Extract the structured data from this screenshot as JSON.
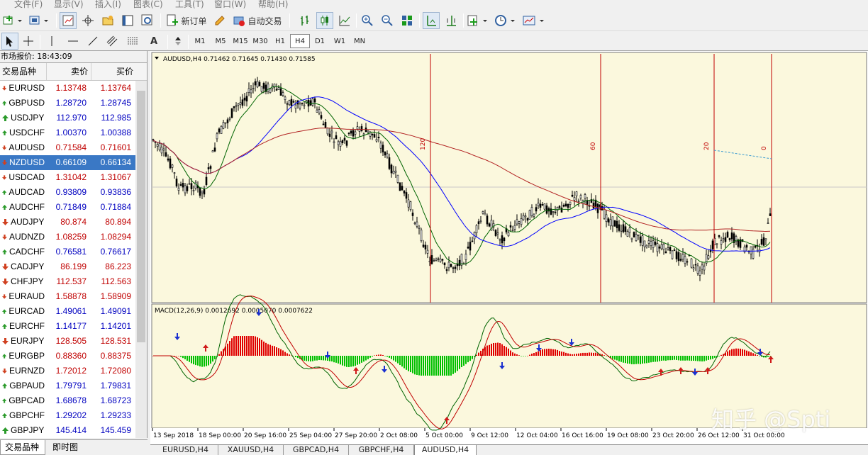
{
  "menu": [
    "文件(F)",
    "显示(V)",
    "插入(I)",
    "图表(C)",
    "工具(T)",
    "窗口(W)",
    "帮助(H)"
  ],
  "toolbar": {
    "new_order": "新订单",
    "auto_trading": "自动交易",
    "text_tool": "A"
  },
  "timeframes": [
    "M1",
    "M5",
    "M15",
    "M30",
    "H1",
    "H4",
    "D1",
    "W1",
    "MN"
  ],
  "active_timeframe": "H4",
  "market_watch": {
    "title": "市场报价: 18:43:09",
    "col_symbol": "交易品种",
    "col_bid": "卖价",
    "col_ask": "买价",
    "rows": [
      {
        "symbol": "EURUSD",
        "bid": "1.13748",
        "ask": "1.13764",
        "dir": "down",
        "color": "#c00000"
      },
      {
        "symbol": "GBPUSD",
        "bid": "1.28720",
        "ask": "1.28745",
        "dir": "up",
        "color": "#0000c0"
      },
      {
        "symbol": "USDJPY",
        "bid": "112.970",
        "ask": "112.985",
        "dir": "up",
        "color": "#0000c0"
      },
      {
        "symbol": "USDCHF",
        "bid": "1.00370",
        "ask": "1.00388",
        "dir": "up",
        "color": "#0000c0"
      },
      {
        "symbol": "AUDUSD",
        "bid": "0.71584",
        "ask": "0.71601",
        "dir": "down",
        "color": "#c00000"
      },
      {
        "symbol": "NZDUSD",
        "bid": "0.66109",
        "ask": "0.66134",
        "dir": "down",
        "color": "#c00000"
      },
      {
        "symbol": "USDCAD",
        "bid": "1.31042",
        "ask": "1.31067",
        "dir": "down",
        "color": "#c00000"
      },
      {
        "symbol": "AUDCAD",
        "bid": "0.93809",
        "ask": "0.93836",
        "dir": "up",
        "color": "#0000c0"
      },
      {
        "symbol": "AUDCHF",
        "bid": "0.71849",
        "ask": "0.71884",
        "dir": "up",
        "color": "#0000c0"
      },
      {
        "symbol": "AUDJPY",
        "bid": "80.874",
        "ask": "80.894",
        "dir": "down",
        "color": "#c00000"
      },
      {
        "symbol": "AUDNZD",
        "bid": "1.08259",
        "ask": "1.08294",
        "dir": "down",
        "color": "#c00000"
      },
      {
        "symbol": "CADCHF",
        "bid": "0.76581",
        "ask": "0.76617",
        "dir": "up",
        "color": "#0000c0"
      },
      {
        "symbol": "CADJPY",
        "bid": "86.199",
        "ask": "86.223",
        "dir": "down",
        "color": "#c00000"
      },
      {
        "symbol": "CHFJPY",
        "bid": "112.537",
        "ask": "112.563",
        "dir": "down",
        "color": "#c00000"
      },
      {
        "symbol": "EURAUD",
        "bid": "1.58878",
        "ask": "1.58909",
        "dir": "down",
        "color": "#c00000"
      },
      {
        "symbol": "EURCAD",
        "bid": "1.49061",
        "ask": "1.49091",
        "dir": "up",
        "color": "#0000c0"
      },
      {
        "symbol": "EURCHF",
        "bid": "1.14177",
        "ask": "1.14201",
        "dir": "up",
        "color": "#0000c0"
      },
      {
        "symbol": "EURJPY",
        "bid": "128.505",
        "ask": "128.531",
        "dir": "down",
        "color": "#c00000"
      },
      {
        "symbol": "EURGBP",
        "bid": "0.88360",
        "ask": "0.88375",
        "dir": "up",
        "color": "#c00000"
      },
      {
        "symbol": "EURNZD",
        "bid": "1.72012",
        "ask": "1.72080",
        "dir": "down",
        "color": "#c00000"
      },
      {
        "symbol": "GBPAUD",
        "bid": "1.79791",
        "ask": "1.79831",
        "dir": "up",
        "color": "#0000c0"
      },
      {
        "symbol": "GBPCAD",
        "bid": "1.68678",
        "ask": "1.68723",
        "dir": "up",
        "color": "#0000c0"
      },
      {
        "symbol": "GBPCHF",
        "bid": "1.29202",
        "ask": "1.29233",
        "dir": "up",
        "color": "#0000c0"
      },
      {
        "symbol": "GBPJPY",
        "bid": "145.414",
        "ask": "145.459",
        "dir": "up",
        "color": "#0000c0"
      }
    ],
    "selected": "NZDUSD",
    "tabs": [
      "交易品种",
      "即时图"
    ]
  },
  "chart": {
    "header": "AUDUSD,H4  0.71462 0.71645 0.71430 0.71585",
    "macd_header": "MACD(12,26,9) 0.0012692 0.0005070 0.0007622",
    "vlines": [
      {
        "label": "120"
      },
      {
        "label": "60"
      },
      {
        "label": "20"
      },
      {
        "label": "0"
      }
    ],
    "time_labels": [
      "13 Sep 2018",
      "18 Sep 00:00",
      "20 Sep 16:00",
      "25 Sep 04:00",
      "27 Sep 20:00",
      "2 Oct 08:00",
      "5 Oct 00:00",
      "9 Oct 12:00",
      "12 Oct 04:00",
      "16 Oct 16:00",
      "19 Oct 08:00",
      "23 Oct 20:00",
      "26 Oct 12:00",
      "31 Oct 00:00"
    ],
    "colors": {
      "bg": "#fbf8dd",
      "up": "#000000",
      "down": "#000000",
      "ma_fast": "#006400",
      "ma_mid": "#0000ff",
      "ma_slow": "#b22222",
      "vline": "#c00000",
      "macd_pos": "#e00000",
      "macd_neg": "#00c000"
    }
  },
  "bottom_tabs": [
    "EURUSD,H4",
    "XAUUSD,H4",
    "GBPCAD,H4",
    "GBPCHF,H4",
    "AUDUSD,H4"
  ],
  "active_tab": "AUDUSD,H4",
  "watermark": "知乎 @Spti"
}
